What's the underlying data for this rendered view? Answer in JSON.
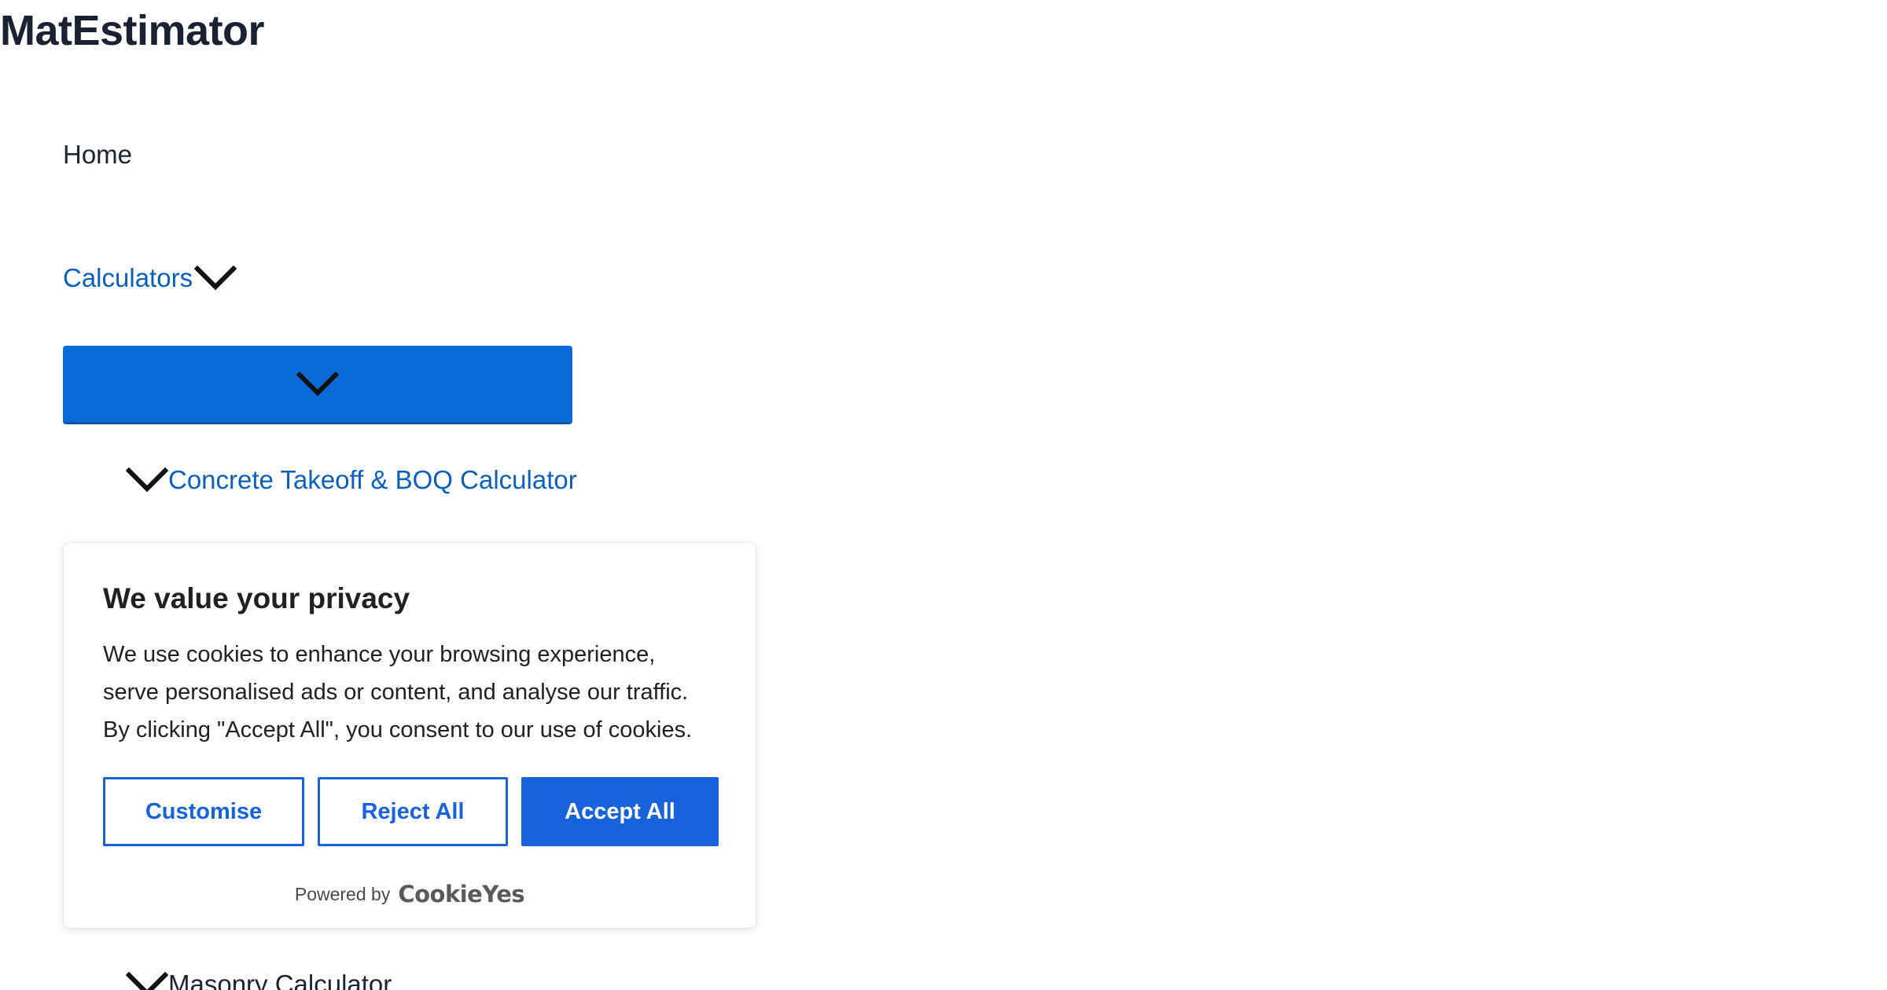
{
  "site": {
    "title": "MatEstimator"
  },
  "nav": {
    "home_label": "Home",
    "calculators_label": "Calculators",
    "submenu": [
      {
        "label": "Concrete Takeoff & BOQ Calculator"
      },
      {
        "label": "Masonry Calculator"
      }
    ]
  },
  "icons": {
    "chevron": "chevron-down-icon"
  },
  "cookie_banner": {
    "title": "We value your privacy",
    "text": "We use cookies to enhance your browsing experience, serve personalised ads or content, and analyse our traffic. By clicking \"Accept All\", you consent to our use of cookies.",
    "customise_label": "Customise",
    "reject_label": "Reject All",
    "accept_label": "Accept All",
    "powered_by": "Powered by",
    "brand": "CookieYes"
  },
  "colors": {
    "accent": "#0a6bd6",
    "link": "#0b5fbd",
    "cookie_primary": "#1863dc",
    "text_dark": "#1c2433"
  }
}
